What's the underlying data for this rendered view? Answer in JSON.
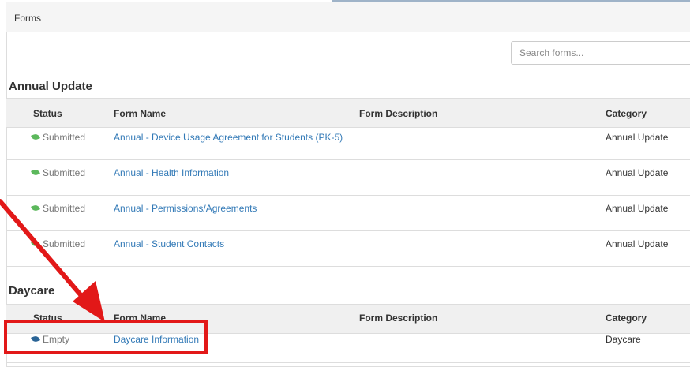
{
  "panel": {
    "title": "Forms"
  },
  "search": {
    "placeholder": "Search forms..."
  },
  "columns": {
    "status": "Status",
    "name": "Form Name",
    "description": "Form Description",
    "category": "Category"
  },
  "sections": [
    {
      "title": "Annual Update",
      "rows": [
        {
          "status": "Submitted",
          "name": "Annual - Device Usage Agreement for Students (PK-5)",
          "description": "",
          "category": "Annual Update"
        },
        {
          "status": "Submitted",
          "name": "Annual - Health Information",
          "description": "",
          "category": "Annual Update"
        },
        {
          "status": "Submitted",
          "name": "Annual - Permissions/Agreements",
          "description": "",
          "category": "Annual Update"
        },
        {
          "status": "Submitted",
          "name": "Annual - Student Contacts",
          "description": "",
          "category": "Annual Update"
        }
      ]
    },
    {
      "title": "Daycare",
      "rows": [
        {
          "status": "Empty",
          "name": "Daycare Information",
          "description": "",
          "category": "Daycare"
        }
      ]
    }
  ],
  "colors": {
    "submitted_icon": "#5cb85c",
    "empty_icon": "#2a6496",
    "link": "#337ab7",
    "annotation": "#e21818"
  },
  "icons": {
    "submitted": "leaf-icon",
    "empty": "leaf-icon"
  }
}
